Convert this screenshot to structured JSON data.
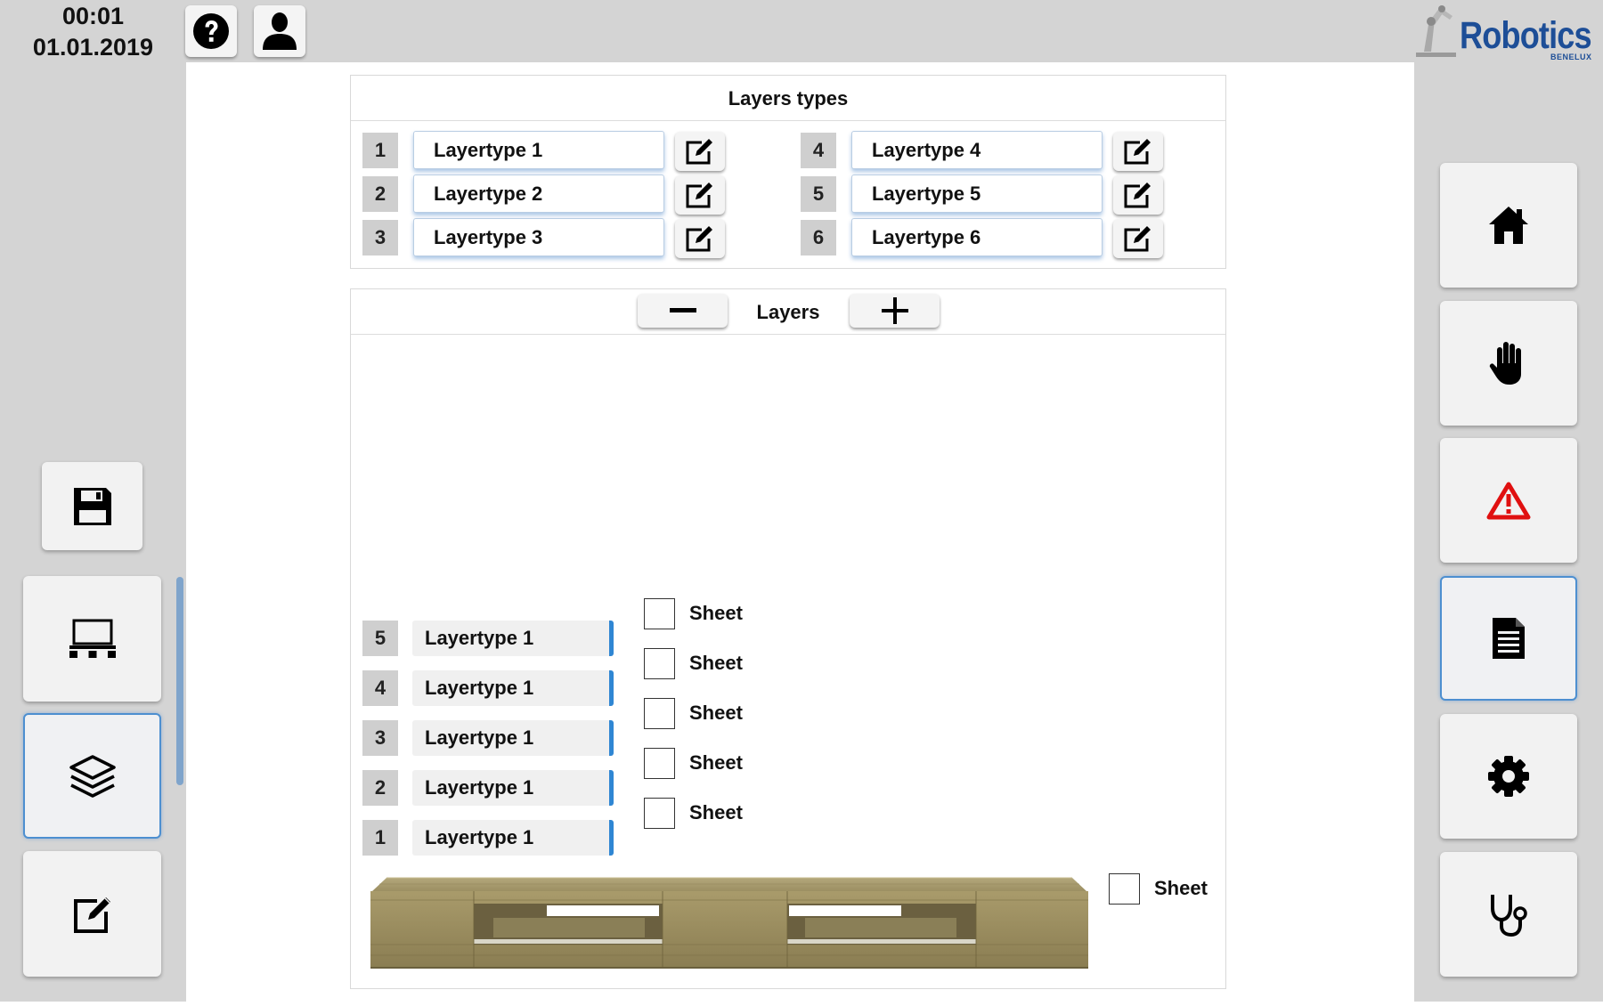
{
  "header": {
    "time": "00:01",
    "date": "01.01.2019",
    "help_icon": "question-circle-icon",
    "user_icon": "user-icon",
    "logo": {
      "text": "Robotics",
      "subtext": "BENELUX",
      "color": "#1d4e97"
    }
  },
  "left_nav": {
    "save_icon": "floppy-disk-icon",
    "items": [
      {
        "name": "pallet",
        "icon": "pallet-icon",
        "active": false
      },
      {
        "name": "layers",
        "icon": "layers-icon",
        "active": true
      },
      {
        "name": "edit",
        "icon": "edit-icon",
        "active": false
      }
    ]
  },
  "right_nav": {
    "items": [
      {
        "name": "home",
        "icon": "home-icon",
        "active": false
      },
      {
        "name": "manual",
        "icon": "hand-icon",
        "active": false
      },
      {
        "name": "alarm",
        "icon": "warning-triangle-icon",
        "active": false,
        "color": "#e01010"
      },
      {
        "name": "recipe",
        "icon": "document-icon",
        "active": true
      },
      {
        "name": "settings",
        "icon": "gear-icon",
        "active": false
      },
      {
        "name": "diagnostics",
        "icon": "stethoscope-icon",
        "active": false
      }
    ]
  },
  "layer_types": {
    "title": "Layers types",
    "items": [
      {
        "num": "1",
        "name": "Layertype 1"
      },
      {
        "num": "2",
        "name": "Layertype 2"
      },
      {
        "num": "3",
        "name": "Layertype 3"
      },
      {
        "num": "4",
        "name": "Layertype 4"
      },
      {
        "num": "5",
        "name": "Layertype 5"
      },
      {
        "num": "6",
        "name": "Layertype 6"
      }
    ]
  },
  "layers": {
    "title": "Layers",
    "stack": [
      {
        "num": "5",
        "type": "Layertype 1",
        "sheet_label": "Sheet",
        "sheet_checked": false
      },
      {
        "num": "4",
        "type": "Layertype 1",
        "sheet_label": "Sheet",
        "sheet_checked": false
      },
      {
        "num": "3",
        "type": "Layertype 1",
        "sheet_label": "Sheet",
        "sheet_checked": false
      },
      {
        "num": "2",
        "type": "Layertype 1",
        "sheet_label": "Sheet",
        "sheet_checked": false
      },
      {
        "num": "1",
        "type": "Layertype 1",
        "sheet_label": "Sheet",
        "sheet_checked": false
      }
    ],
    "bottom_sheet": {
      "label": "Sheet",
      "checked": false
    }
  },
  "colors": {
    "accent": "#2f86d3",
    "chrome": "#d4d4d4",
    "logo": "#1d4e97",
    "alarm": "#e01010"
  }
}
